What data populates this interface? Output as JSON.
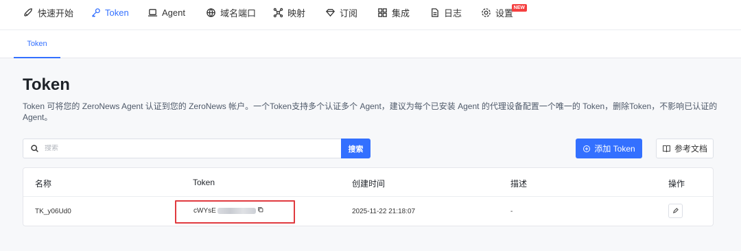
{
  "nav": {
    "items": [
      {
        "label": "快速开始",
        "icon": "rocket-icon"
      },
      {
        "label": "Token",
        "icon": "key-icon",
        "active": true
      },
      {
        "label": "Agent",
        "icon": "laptop-icon"
      },
      {
        "label": "域名端口",
        "icon": "globe-icon"
      },
      {
        "label": "映射",
        "icon": "mapping-icon"
      },
      {
        "label": "订阅",
        "icon": "diamond-icon"
      },
      {
        "label": "集成",
        "icon": "grid-icon"
      },
      {
        "label": "日志",
        "icon": "document-icon"
      },
      {
        "label": "设置",
        "icon": "gear-icon",
        "badge": "NEW"
      }
    ]
  },
  "subtabs": {
    "active": "Token"
  },
  "page": {
    "title": "Token",
    "description": "Token 可将您的 ZeroNews Agent 认证到您的 ZeroNews 帐户。一个Token支持多个认证多个 Agent，建议为每个已安装 Agent 的代理设备配置一个唯一的 Token，删除Token，不影响已认证的 Agent。"
  },
  "search": {
    "placeholder": "搜索",
    "value": "",
    "button_label": "搜索"
  },
  "actions": {
    "add_label": "添加 Token",
    "docs_label": "参考文档"
  },
  "table": {
    "headers": [
      "名称",
      "Token",
      "创建时间",
      "描述",
      "操作"
    ],
    "rows": [
      {
        "name": "TK_y06Ud0",
        "token_visible": "cWYsE",
        "created": "2025-11-22 21:18:07",
        "desc": "-"
      }
    ]
  },
  "colors": {
    "accent": "#3370ff",
    "highlight": "#e0393e",
    "badge": "#f53f3f"
  }
}
